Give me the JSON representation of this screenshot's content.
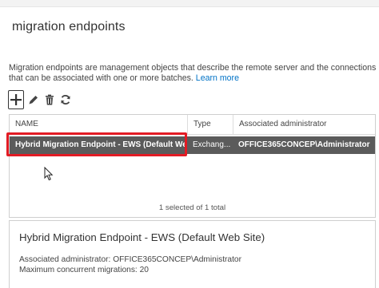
{
  "page": {
    "title": "migration endpoints",
    "description": "Migration endpoints are management objects that describe the remote server and the connections that can be associated with one or more batches.",
    "learn_more": "Learn more"
  },
  "toolbar": {
    "add_icon": "plus-icon",
    "edit_icon": "pencil-icon",
    "delete_icon": "trash-icon",
    "refresh_icon": "refresh-icon"
  },
  "table": {
    "columns": [
      "NAME",
      "Type",
      "Associated administrator"
    ],
    "rows": [
      {
        "name": "Hybrid Migration Endpoint - EWS (Default We...",
        "type": "Exchang...",
        "admin": "OFFICE365CONCEP\\Administrator"
      }
    ],
    "selection_status": "1 selected of 1 total"
  },
  "details": {
    "title": "Hybrid Migration Endpoint - EWS (Default Web Site)",
    "admin_line": "Associated administrator: OFFICE365CONCEP\\Administrator",
    "max_line": "Maximum concurrent migrations: 20"
  },
  "colors": {
    "link": "#0072c6",
    "selected_row": "#5b5b5b",
    "highlight_border": "#e21b24"
  }
}
